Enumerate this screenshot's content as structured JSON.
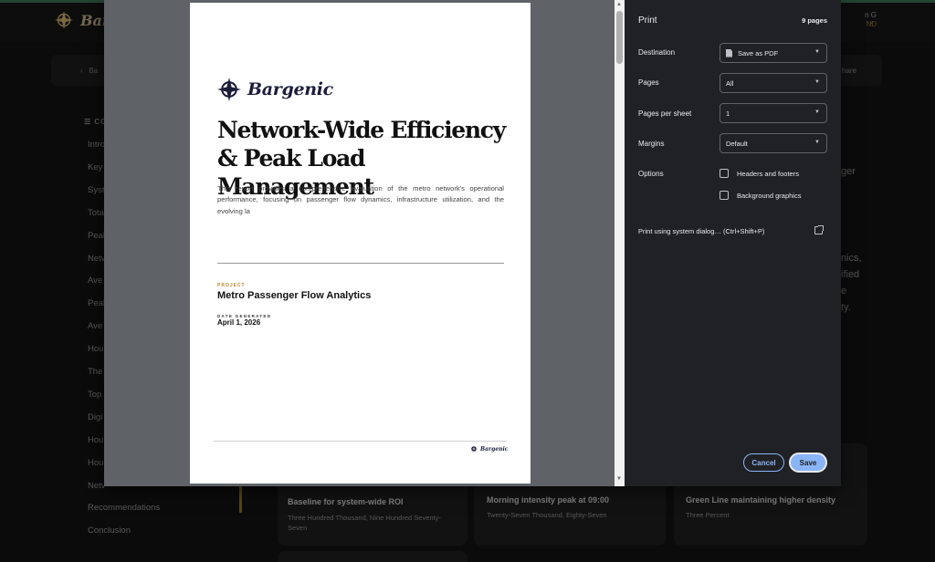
{
  "app": {
    "brand": "Bargenic",
    "user_name": "n G",
    "user_sub": "ND",
    "back_label": "Ba",
    "share_label": "hare",
    "toc_label": "CO",
    "toc_items": [
      "Intro",
      "Key",
      "Syst",
      "Tota",
      "Peal",
      "Netv",
      "Ave",
      "Peal",
      "Ave",
      "Hou",
      "The",
      "Top",
      "Digi",
      "Hou",
      "Hou",
      "Netv",
      "Recommendations",
      "Conclusion"
    ],
    "right_col": [
      "ger",
      "nics,",
      "ified",
      "e",
      "ty."
    ],
    "cards": [
      {
        "title": "Baseline for system-wide ROI",
        "sub": "Three Hundred Thousand, Nine Hundred Seventy-Seven"
      },
      {
        "title": "Morning intensity peak at 09:00",
        "sub": "Twenty-Seven Thousand, Eighty-Seven"
      },
      {
        "title": "Green Line maintaining higher density",
        "sub": "Three Percent"
      }
    ]
  },
  "preview": {
    "brand": "Bargenic",
    "title": "Network-Wide Efficiency & Peak Load Management",
    "intro": "This report provides a comprehensive evaluation of the metro network's operational performance, focusing on passenger flow dynamics, infrastructure utilization, and the evolving la",
    "project_label": "PROJECT",
    "project_name": "Metro Passenger Flow Analytics",
    "date_label": "DATE GENERATED",
    "date_value": "April 1, 2026",
    "footer_brand": "Bargenic"
  },
  "print": {
    "title": "Print",
    "page_count": "9 pages",
    "destination_label": "Destination",
    "destination_value": "Save as PDF",
    "pages_label": "Pages",
    "pages_value": "All",
    "per_sheet_label": "Pages per sheet",
    "per_sheet_value": "1",
    "margins_label": "Margins",
    "margins_value": "Default",
    "options_label": "Options",
    "opt_headers": "Headers and footers",
    "opt_background": "Background graphics",
    "system_dialog": "Print using system dialog… (Ctrl+Shift+P)",
    "cancel": "Cancel",
    "save": "Save"
  },
  "colors": {
    "accent": "#8ab4f8",
    "dialog_bg": "#202124",
    "brand_gold": "#b8862b",
    "brand_navy": "#1b1d3a"
  }
}
